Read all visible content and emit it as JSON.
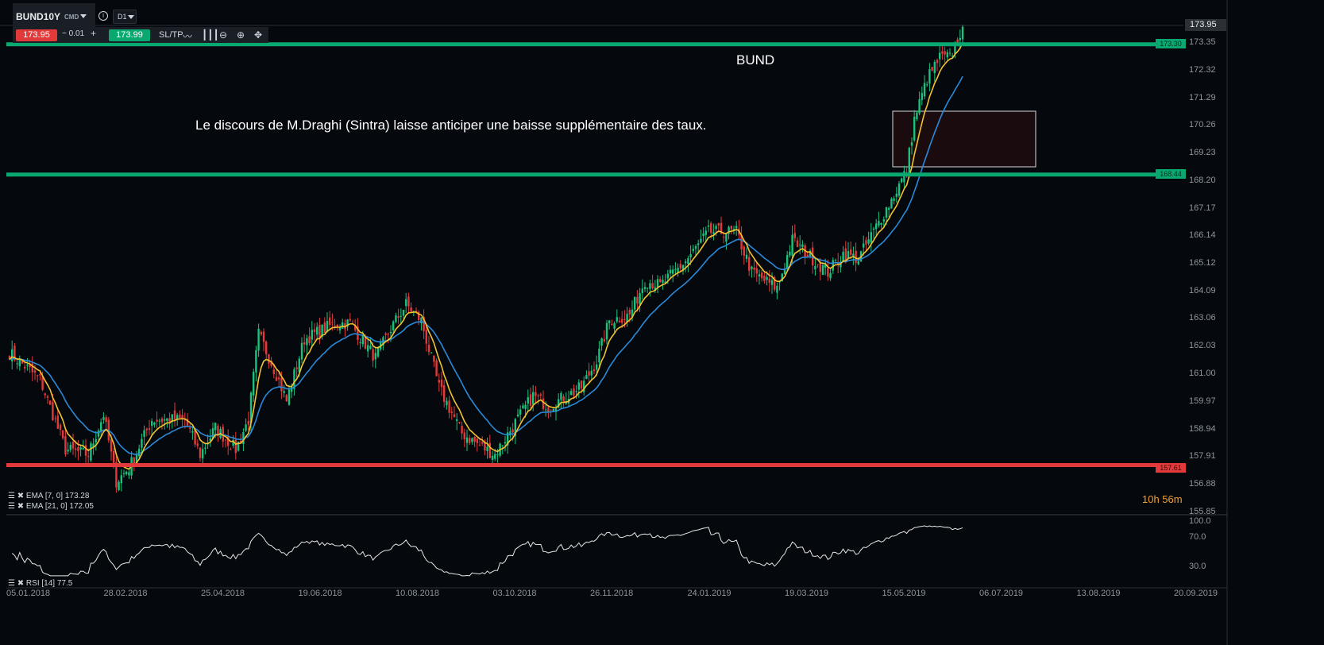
{
  "toolbar": {
    "symbol": "BUND10Y",
    "market": "CMD",
    "timeframe": "D1",
    "sell_price": "173.95",
    "quantity": "0.01",
    "minus": "−",
    "plus": "+",
    "buy_price": "173.99",
    "sltp": "SL/TP",
    "info": "i"
  },
  "colors": {
    "bg": "#05080c",
    "up": "#19c37d",
    "down": "#e23a3a",
    "ema7": "#f2c230",
    "ema21": "#2a8ad8",
    "level_green": "#0aa871",
    "level_red": "#e23a3a"
  },
  "price_axis": [
    "173.35",
    "172.32",
    "171.29",
    "170.26",
    "169.23",
    "168.20",
    "167.17",
    "166.14",
    "165.12",
    "164.09",
    "163.06",
    "162.03",
    "161.00",
    "159.97",
    "158.94",
    "157.91",
    "156.88",
    "155.85"
  ],
  "current_price": "173.95",
  "levels": [
    {
      "value": "173.30",
      "color": "green"
    },
    {
      "value": "168.44",
      "color": "green"
    },
    {
      "value": "157.61",
      "color": "red"
    }
  ],
  "annotations": {
    "title": "BUND",
    "comment": "Le discours de M.Draghi (Sintra) laisse anticiper une baisse supplémentaire des taux."
  },
  "indicators": {
    "ema7": "EMA [7, 0] 173.28",
    "ema21": "EMA [21, 0] 172.05",
    "rsi": "RSI [14] 77.5"
  },
  "rsi_axis": [
    "100.0",
    "70.0",
    "30.0"
  ],
  "timer": "10h 56m",
  "dates": [
    "05.01.2018",
    "28.02.2018",
    "25.04.2018",
    "19.06.2018",
    "10.08.2018",
    "03.10.2018",
    "26.11.2018",
    "24.01.2019",
    "19.03.2019",
    "15.05.2019",
    "06.07.2019",
    "13.08.2019",
    "20.09.2019"
  ],
  "chart_data": {
    "type": "candlestick",
    "price_range": [
      155.85,
      173.35
    ],
    "close_path": [
      [
        0,
        161.8
      ],
      [
        12,
        160.8
      ],
      [
        22,
        158.2
      ],
      [
        31,
        158.0
      ],
      [
        37,
        159.5
      ],
      [
        42,
        157.0
      ],
      [
        47,
        157.5
      ],
      [
        56,
        159.3
      ],
      [
        69,
        159.3
      ],
      [
        75,
        158.0
      ],
      [
        81,
        159.0
      ],
      [
        89,
        158.2
      ],
      [
        94,
        159.3
      ],
      [
        98,
        162.5
      ],
      [
        105,
        161.0
      ],
      [
        109,
        160.0
      ],
      [
        116,
        162.3
      ],
      [
        128,
        162.9
      ],
      [
        134,
        162.9
      ],
      [
        144,
        161.6
      ],
      [
        150,
        162.7
      ],
      [
        156,
        163.6
      ],
      [
        162,
        163.0
      ],
      [
        169,
        160.5
      ],
      [
        178,
        158.8
      ],
      [
        184,
        158.4
      ],
      [
        191,
        158.0
      ],
      [
        197,
        158.9
      ],
      [
        206,
        160.2
      ],
      [
        212,
        159.8
      ],
      [
        225,
        160.5
      ],
      [
        231,
        161.5
      ],
      [
        236,
        163.0
      ],
      [
        244,
        163.2
      ],
      [
        250,
        164.5
      ],
      [
        256,
        164.3
      ],
      [
        266,
        165.2
      ],
      [
        275,
        166.3
      ],
      [
        286,
        166.3
      ],
      [
        292,
        164.8
      ],
      [
        302,
        164.2
      ],
      [
        308,
        166.0
      ],
      [
        316,
        165.3
      ],
      [
        322,
        164.8
      ],
      [
        328,
        165.5
      ],
      [
        334,
        165.3
      ],
      [
        341,
        166.5
      ],
      [
        347,
        167.5
      ],
      [
        353,
        168.6
      ],
      [
        356,
        170.5
      ],
      [
        361,
        172.0
      ],
      [
        366,
        172.8
      ],
      [
        370,
        172.8
      ],
      [
        375,
        173.95
      ]
    ]
  }
}
